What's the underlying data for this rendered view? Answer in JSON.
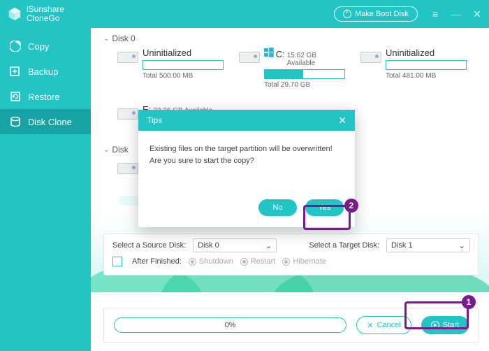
{
  "colors": {
    "accent": "#22c4c4",
    "annot": "#7a1b8c"
  },
  "titlebar": {
    "product_line1": "iSunshare",
    "product_line2": "CloneGo",
    "make_boot_label": "Make Boot Disk"
  },
  "sidebar": {
    "items": [
      {
        "label": "Copy"
      },
      {
        "label": "Backup"
      },
      {
        "label": "Restore"
      },
      {
        "label": "Disk Clone"
      }
    ],
    "active_index": 3
  },
  "disks": [
    {
      "name": "Disk 0",
      "partitions": [
        {
          "label": "Uninitialized",
          "avail": "",
          "total": "Total 500.00 MB",
          "fill_pct": 0,
          "has_win": false
        },
        {
          "label": "C:",
          "avail": "15.62 GB Available",
          "total": "Total 29.70 GB",
          "fill_pct": 48,
          "has_win": true
        },
        {
          "label": "Uninitialized",
          "avail": "",
          "total": "Total 481.00 MB",
          "fill_pct": 0,
          "has_win": false
        },
        {
          "label": "E:",
          "avail": "33.26 GB Available",
          "total": "",
          "fill_pct": 0,
          "has_win": false
        }
      ]
    },
    {
      "name": "Disk",
      "partitions": [
        {
          "label": "",
          "avail": "",
          "total": "",
          "fill_pct": 0,
          "has_win": false
        }
      ]
    }
  ],
  "selectors": {
    "source_label": "Select a Source Disk:",
    "source_value": "Disk 0",
    "target_label": "Select a Target Disk:",
    "target_value": "Disk 1",
    "after_label": "After Finished:",
    "options": [
      "Shutdown",
      "Restart",
      "Hibernate"
    ]
  },
  "footer": {
    "progress_text": "0%",
    "cancel_label": "Cancel",
    "start_label": "Start"
  },
  "modal": {
    "title": "Tips",
    "message": "Existing files on the target partition will be overwritten! Are you sure to start the copy?",
    "no_label": "No",
    "yes_label": "Yes"
  },
  "annotations": {
    "one": "1",
    "two": "2"
  }
}
